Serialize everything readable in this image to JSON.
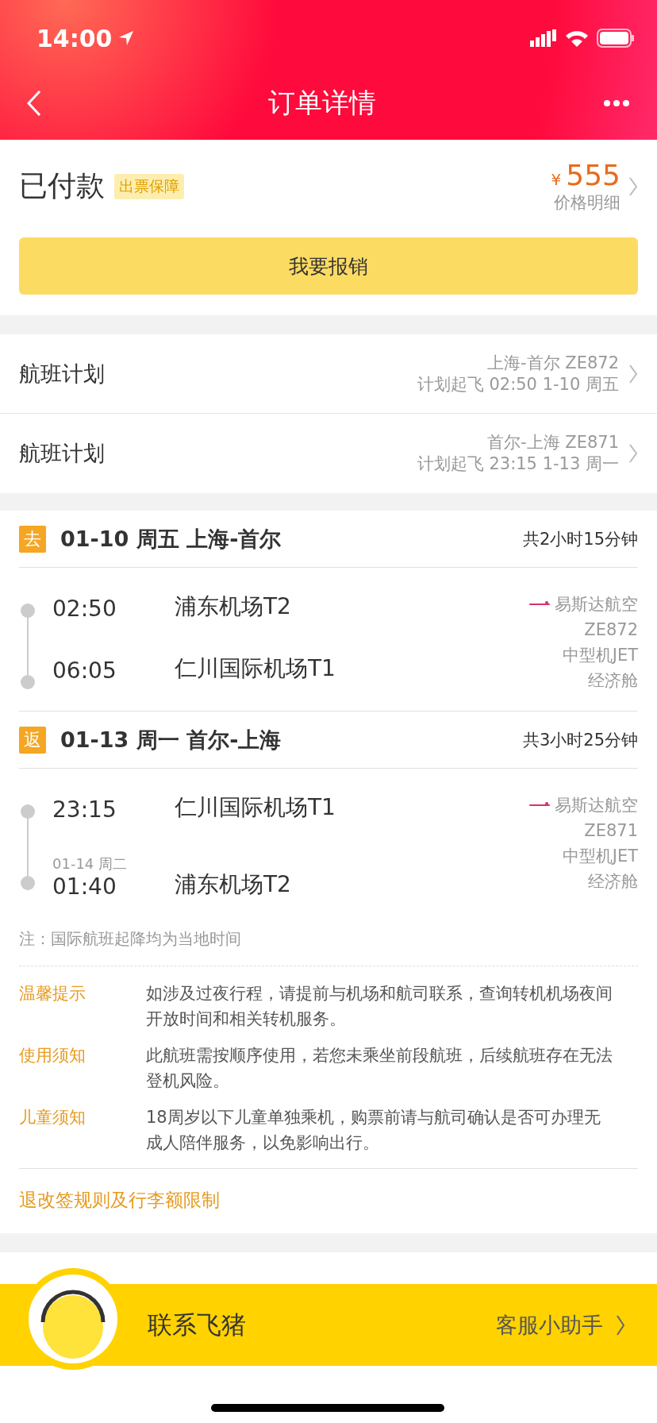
{
  "status_bar": {
    "time": "14:00"
  },
  "nav": {
    "title": "订单详情"
  },
  "order": {
    "status": "已付款",
    "badge": "出票保障",
    "currency": "¥",
    "price": "555",
    "price_link": "价格明细",
    "action": "我要报销"
  },
  "flight_plans": [
    {
      "label": "航班计划",
      "route": "上海-首尔 ZE872",
      "departure": "计划起飞 02:50 1-10 周五"
    },
    {
      "label": "航班计划",
      "route": "首尔-上海 ZE871",
      "departure": "计划起飞 23:15 1-13 周一"
    }
  ],
  "trips": [
    {
      "tag": "去",
      "title": "01-10 周五 上海-首尔",
      "duration": "共2小时15分钟",
      "depart_time": "02:50",
      "depart_airport": "浦东机场T2",
      "arrive_time": "06:05",
      "arrive_airport": "仁川国际机场T1",
      "airline": "易斯达航空",
      "flight_no": "ZE872",
      "aircraft": "中型机JET",
      "cabin": "经济舱"
    },
    {
      "tag": "返",
      "title": "01-13 周一 首尔-上海",
      "duration": "共3小时25分钟",
      "depart_time": "23:15",
      "depart_airport": "仁川国际机场T1",
      "arrive_date": "01-14 周二",
      "arrive_time": "01:40",
      "arrive_airport": "浦东机场T2",
      "airline": "易斯达航空",
      "flight_no": "ZE871",
      "aircraft": "中型机JET",
      "cabin": "经济舱"
    }
  ],
  "note": "注：国际航班起降均为当地时间",
  "tips": [
    {
      "label": "温馨提示",
      "text": "如涉及过夜行程，请提前与机场和航司联系，查询转机机场夜间开放时间和相关转机服务。"
    },
    {
      "label": "使用须知",
      "text": "此航班需按顺序使用，若您未乘坐前段航班，后续航班存在无法登机风险。"
    },
    {
      "label": "儿童须知",
      "text": "18周岁以下儿童单独乘机，购票前请与航司确认是否可办理无成人陪伴服务，以免影响出行。"
    }
  ],
  "rules_link": "退改签规则及行李额限制",
  "contact": {
    "title": "联系飞猪",
    "assistant": "客服小助手"
  }
}
